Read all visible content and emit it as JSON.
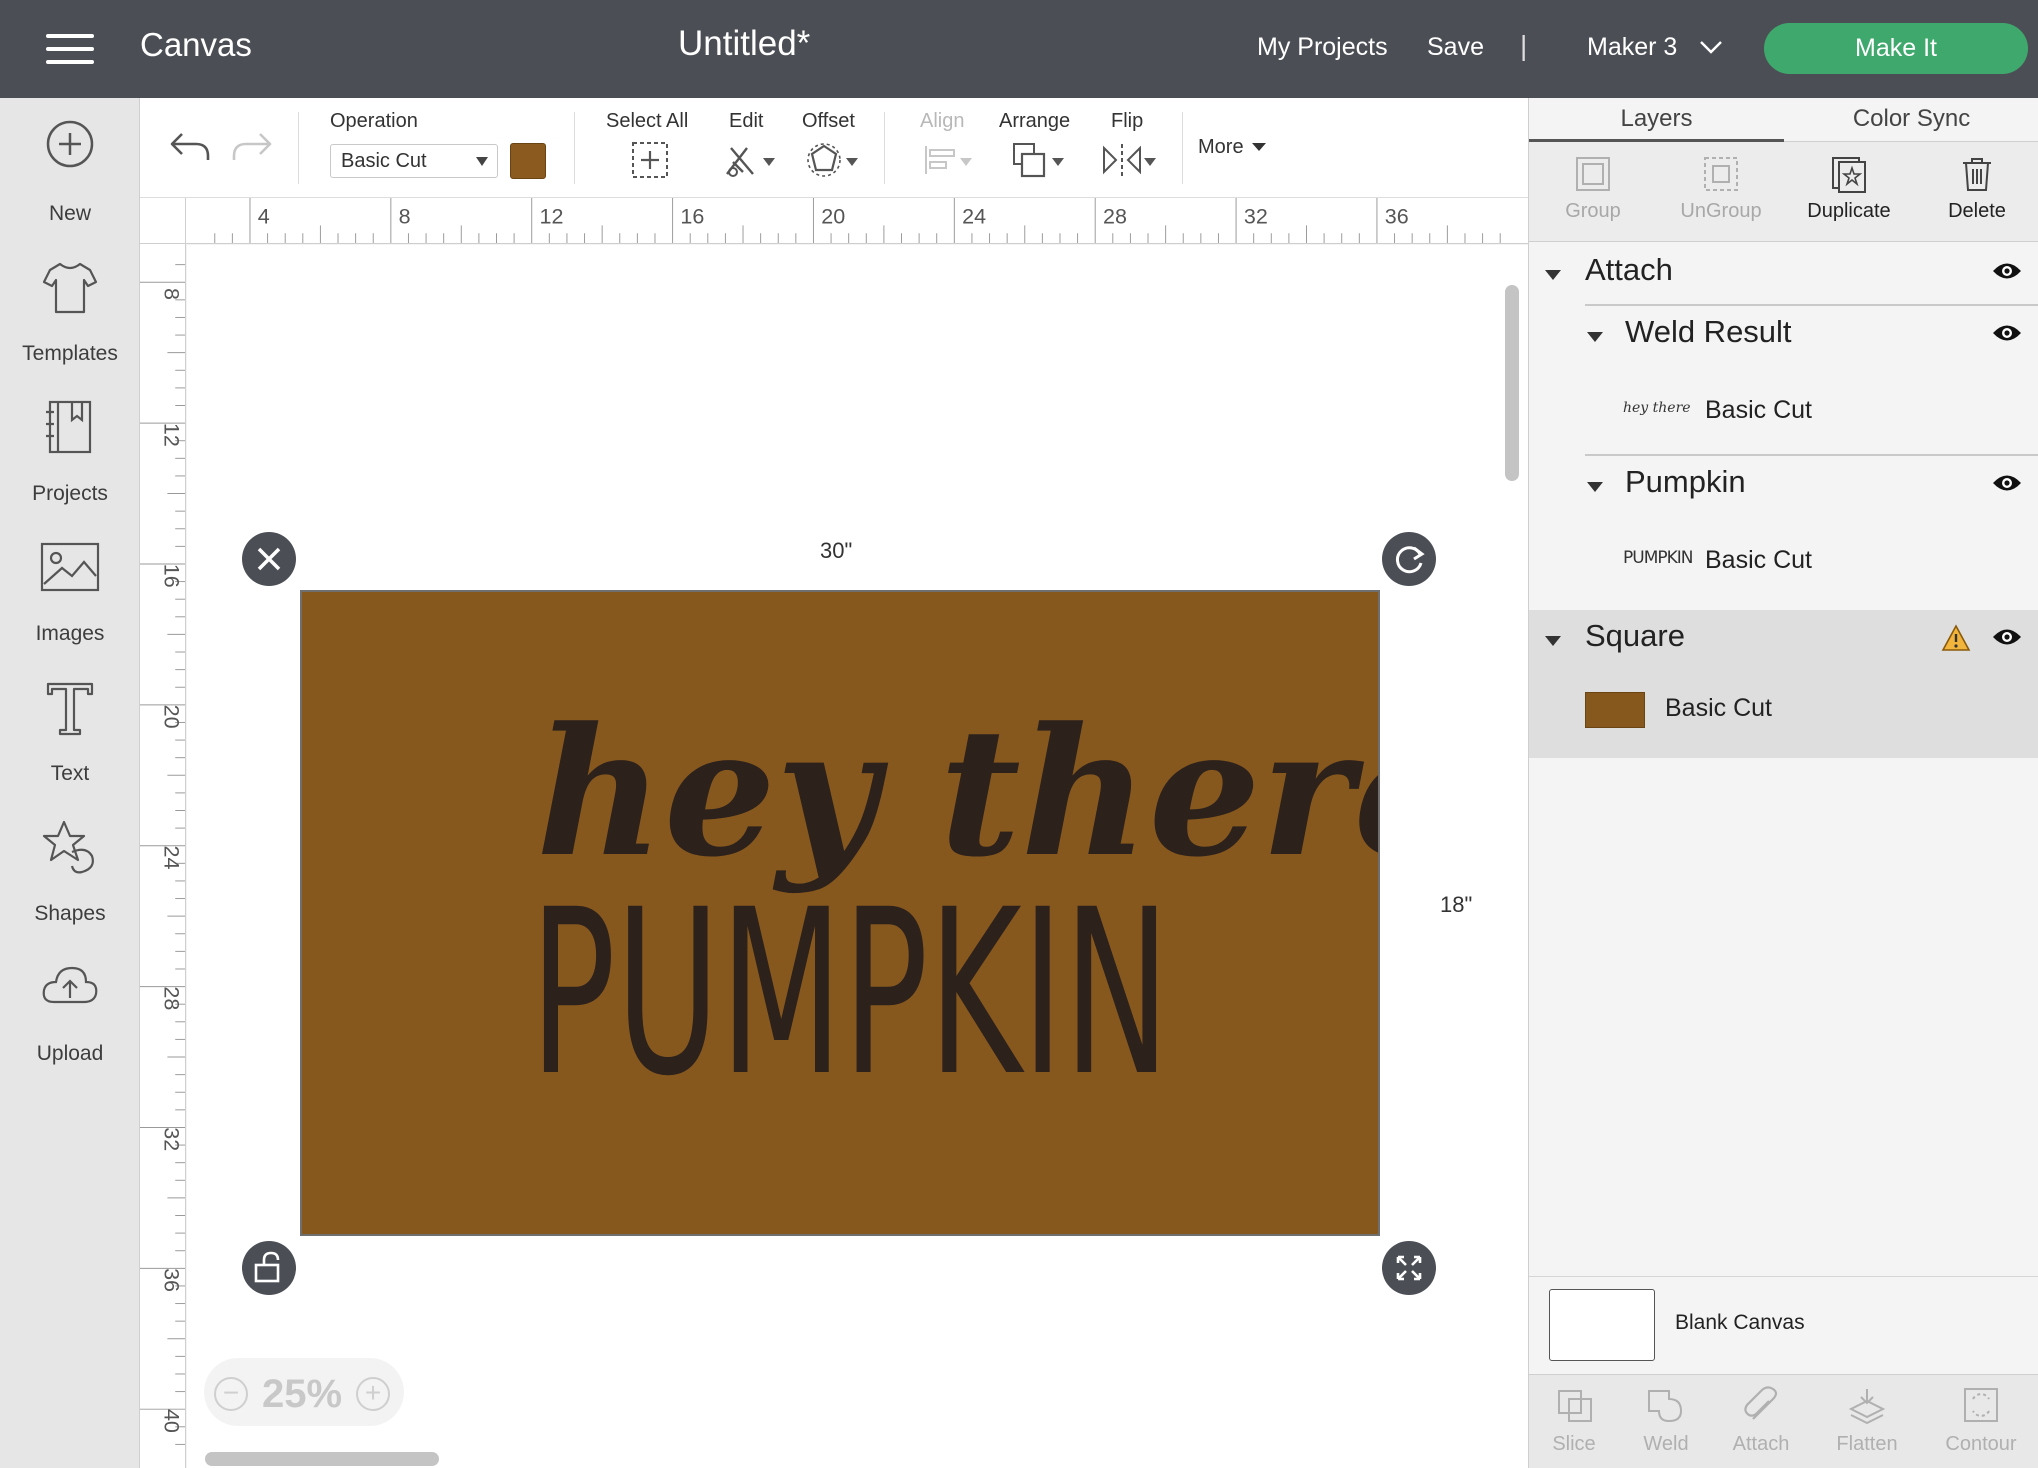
{
  "header": {
    "app_title": "Canvas",
    "doc_title": "Untitled*",
    "my_projects": "My Projects",
    "save": "Save",
    "separator": "|",
    "machine": "Maker 3",
    "make_it": "Make It"
  },
  "sidebar": {
    "items": [
      {
        "label": "New",
        "icon": "plus-circle-icon"
      },
      {
        "label": "Templates",
        "icon": "tshirt-icon"
      },
      {
        "label": "Projects",
        "icon": "book-icon"
      },
      {
        "label": "Images",
        "icon": "image-icon"
      },
      {
        "label": "Text",
        "icon": "text-icon"
      },
      {
        "label": "Shapes",
        "icon": "shapes-icon"
      },
      {
        "label": "Upload",
        "icon": "cloud-upload-icon"
      }
    ]
  },
  "toolbar": {
    "operation_label": "Operation",
    "operation_value": "Basic Cut",
    "operation_color": "#8a5a1f",
    "select_all": "Select All",
    "edit": "Edit",
    "offset": "Offset",
    "align": "Align",
    "arrange": "Arrange",
    "flip": "Flip",
    "more": "More"
  },
  "rulers": {
    "horizontal": [
      "4",
      "8",
      "12",
      "16",
      "20",
      "24",
      "28",
      "32",
      "36"
    ],
    "vertical": [
      "8",
      "12",
      "16",
      "20",
      "24",
      "28",
      "32",
      "36",
      "40"
    ]
  },
  "canvas": {
    "width_label": "30\"",
    "height_label": "18\"",
    "design_line1": "hey there",
    "design_line2": "PUMPKIN",
    "design_bg": "#87581e",
    "design_text_color": "#2c211b",
    "zoom": "25%"
  },
  "panel": {
    "tabs": [
      "Layers",
      "Color Sync"
    ],
    "layer_tools": [
      "Group",
      "UnGroup",
      "Duplicate",
      "Delete"
    ],
    "layers": {
      "attach": "Attach",
      "weld_result": "Weld Result",
      "weld_thumb": "hey there",
      "weld_op": "Basic Cut",
      "pumpkin": "Pumpkin",
      "pumpkin_thumb": "PUMPKIN",
      "pumpkin_op": "Basic Cut",
      "square": "Square",
      "square_op": "Basic Cut"
    },
    "blank_canvas": "Blank Canvas",
    "bottom_tools": [
      "Slice",
      "Weld",
      "Attach",
      "Flatten",
      "Contour"
    ]
  }
}
